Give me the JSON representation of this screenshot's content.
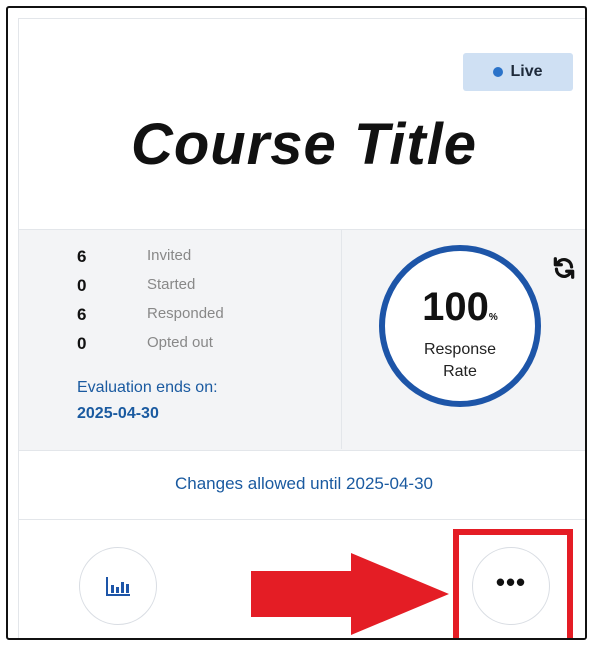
{
  "status_badge": {
    "label": "Live",
    "dot_color": "#2b73c9"
  },
  "course": {
    "title": "Course Title"
  },
  "stats": [
    {
      "value": "6",
      "label": "Invited"
    },
    {
      "value": "0",
      "label": "Started"
    },
    {
      "value": "6",
      "label": "Responded"
    },
    {
      "value": "0",
      "label": "Opted out"
    }
  ],
  "evaluation": {
    "label": "Evaluation ends on:",
    "date": "2025-04-30"
  },
  "response_rate": {
    "value": "100",
    "unit": "%",
    "label_line1": "Response",
    "label_line2": "Rate"
  },
  "changes_notice": "Changes allowed until 2025-04-30",
  "icons": {
    "refresh": "refresh-icon",
    "chart": "bar-chart-icon",
    "more": "more-horizontal-icon"
  },
  "colors": {
    "accent": "#1d55a8",
    "link": "#1a5aa0",
    "highlight": "#e41d25",
    "badge_bg": "#cfe0f3"
  }
}
